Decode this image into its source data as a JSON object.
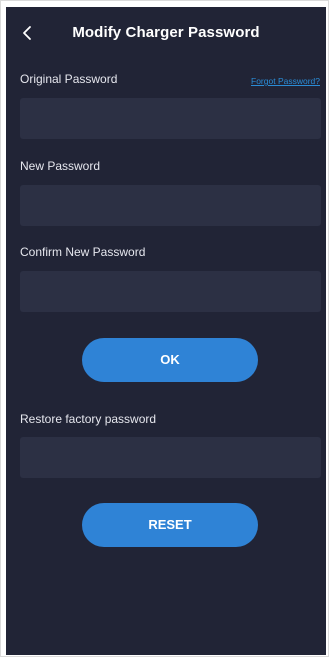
{
  "header": {
    "title": "Modify Charger Password"
  },
  "form": {
    "original_password": {
      "label": "Original Password",
      "value": "",
      "placeholder": ""
    },
    "forgot_password_link": "Forgot Password?",
    "new_password": {
      "label": "New Password",
      "value": "",
      "placeholder": ""
    },
    "confirm_password": {
      "label": "Confirm New Password",
      "value": "",
      "placeholder": ""
    },
    "ok_button": "OK",
    "restore": {
      "label": "Restore factory password",
      "value": "",
      "placeholder": ""
    },
    "reset_button": "RESET"
  },
  "colors": {
    "background": "#212436",
    "field": "#2c3044",
    "accent": "#2f83d6",
    "link": "#2a8cd6"
  },
  "icons": {
    "back": "chevron-left-icon"
  }
}
